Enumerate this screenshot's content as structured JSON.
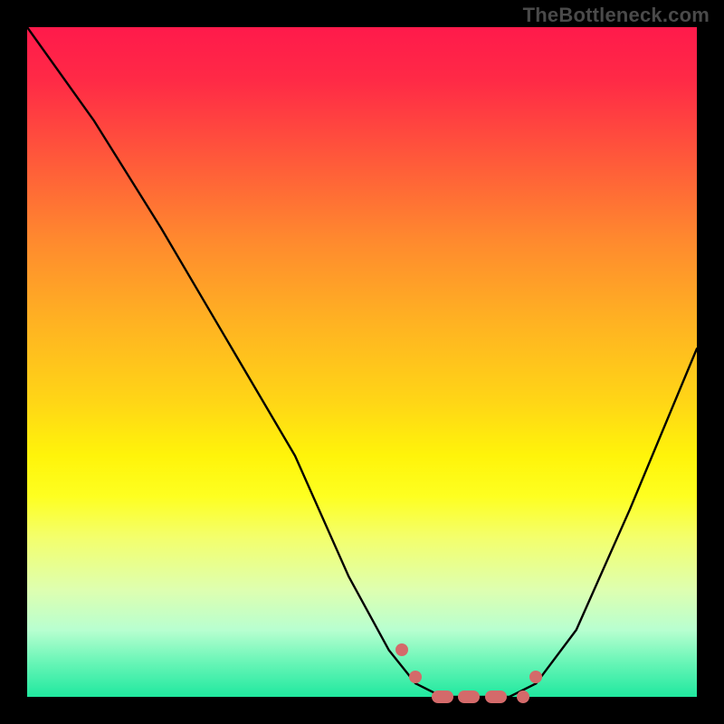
{
  "watermark_text": "TheBottleneck.com",
  "colors": {
    "background": "#000000",
    "watermark": "#4a4a4a",
    "curve": "#000000",
    "marker": "#d46a6a"
  },
  "chart_data": {
    "type": "line",
    "title": "",
    "xlabel": "",
    "ylabel": "",
    "x_range": [
      0,
      100
    ],
    "y_range_percent_mismatch": [
      0,
      100
    ],
    "note": "Heatmap background: red=high bottleneck, green=zero bottleneck. V-shaped black curve shows mismatch; pink markers sit at the flat optimal zone.",
    "curve_points": [
      {
        "x": 0,
        "y": 100
      },
      {
        "x": 10,
        "y": 86
      },
      {
        "x": 20,
        "y": 70
      },
      {
        "x": 30,
        "y": 53
      },
      {
        "x": 40,
        "y": 36
      },
      {
        "x": 48,
        "y": 18
      },
      {
        "x": 54,
        "y": 7
      },
      {
        "x": 58,
        "y": 2
      },
      {
        "x": 62,
        "y": 0
      },
      {
        "x": 68,
        "y": 0
      },
      {
        "x": 72,
        "y": 0
      },
      {
        "x": 76,
        "y": 2
      },
      {
        "x": 82,
        "y": 10
      },
      {
        "x": 90,
        "y": 28
      },
      {
        "x": 100,
        "y": 52
      }
    ],
    "optimal_markers_x": [
      56,
      58,
      62,
      66,
      70,
      74,
      76
    ]
  }
}
